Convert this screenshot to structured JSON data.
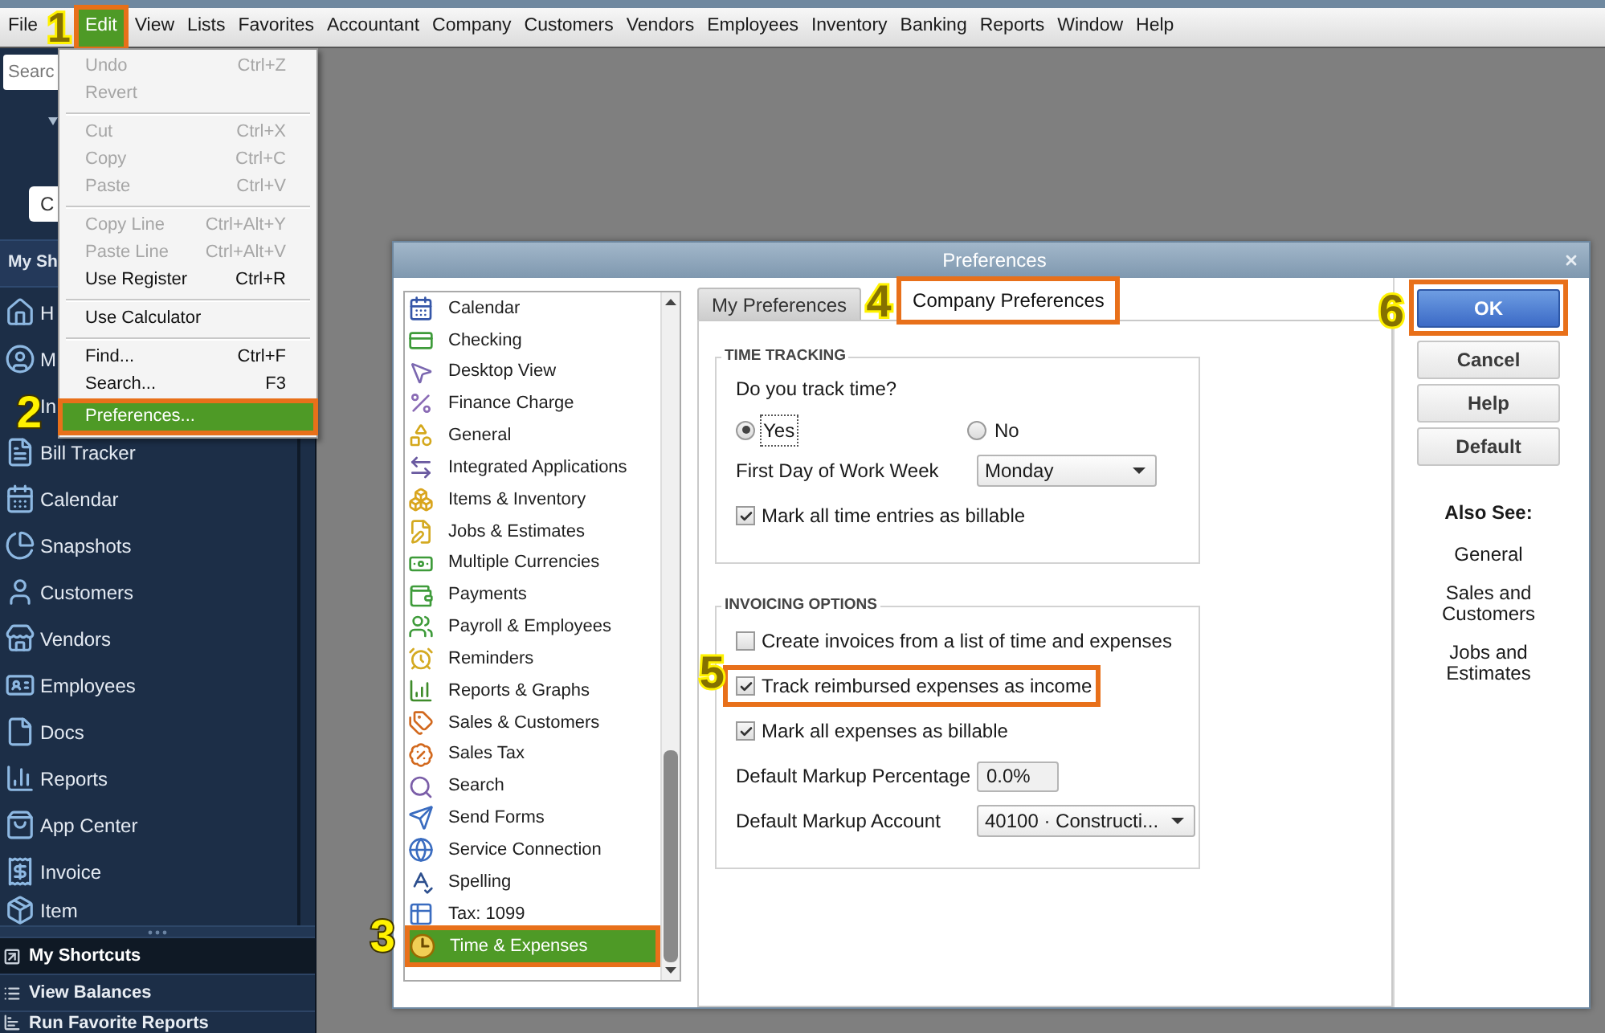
{
  "menu_bar": [
    {
      "label": "File",
      "selected": false
    },
    {
      "label": "Edit",
      "selected": true,
      "callout": "1"
    },
    {
      "label": "View",
      "selected": false
    },
    {
      "label": "Lists",
      "selected": false
    },
    {
      "label": "Favorites",
      "selected": false
    },
    {
      "label": "Accountant",
      "selected": false
    },
    {
      "label": "Company",
      "selected": false
    },
    {
      "label": "Customers",
      "selected": false
    },
    {
      "label": "Vendors",
      "selected": false
    },
    {
      "label": "Employees",
      "selected": false
    },
    {
      "label": "Inventory",
      "selected": false
    },
    {
      "label": "Banking",
      "selected": false
    },
    {
      "label": "Reports",
      "selected": false
    },
    {
      "label": "Window",
      "selected": false
    },
    {
      "label": "Help",
      "selected": false
    }
  ],
  "edit_menu": {
    "groups": [
      [
        {
          "label": "Undo",
          "shortcut": "Ctrl+Z",
          "disabled": true,
          "selected": false
        },
        {
          "label": "Revert",
          "disabled": true,
          "selected": false
        }
      ],
      [
        {
          "label": "Cut",
          "shortcut": "Ctrl+X",
          "disabled": true,
          "selected": false
        },
        {
          "label": "Copy",
          "shortcut": "Ctrl+C",
          "disabled": true,
          "selected": false
        },
        {
          "label": "Paste",
          "shortcut": "Ctrl+V",
          "disabled": true,
          "selected": false
        }
      ],
      [
        {
          "label": "Copy Line",
          "shortcut": "Ctrl+Alt+Y",
          "disabled": true,
          "selected": false
        },
        {
          "label": "Paste Line",
          "shortcut": "Ctrl+Alt+V",
          "disabled": true,
          "selected": false
        },
        {
          "label": "Use Register",
          "shortcut": "Ctrl+R",
          "disabled": false,
          "selected": false
        }
      ],
      [
        {
          "label": "Use Calculator",
          "disabled": false,
          "selected": false
        }
      ],
      [
        {
          "label": "Find...",
          "shortcut": "Ctrl+F",
          "disabled": false,
          "selected": false
        },
        {
          "label": "Search...",
          "shortcut": "F3",
          "disabled": false,
          "selected": false
        },
        {
          "label": "Preferences...",
          "disabled": false,
          "selected": true,
          "callout": "2"
        }
      ]
    ]
  },
  "sidebar": {
    "search": {
      "placeholder": "Searc"
    },
    "button": "C",
    "section_title": "My Sh",
    "items": [
      {
        "label": "H"
      },
      {
        "label": "M"
      },
      {
        "label": "In"
      },
      {
        "label": "Bill Tracker"
      },
      {
        "label": "Calendar"
      },
      {
        "label": "Snapshots"
      },
      {
        "label": "Customers"
      },
      {
        "label": "Vendors"
      },
      {
        "label": "Employees"
      },
      {
        "label": "Docs"
      },
      {
        "label": "Reports"
      },
      {
        "label": "App Center"
      },
      {
        "label": "Invoice"
      },
      {
        "label": "Item"
      }
    ],
    "panels": [
      {
        "label": "My Shortcuts",
        "selected": true
      },
      {
        "label": "View Balances",
        "selected": false
      },
      {
        "label": "Run Favorite Reports",
        "selected": false
      }
    ]
  },
  "preferences_dialog": {
    "title": "Preferences",
    "categories": [
      {
        "label": "Calendar",
        "selected": false
      },
      {
        "label": "Checking",
        "selected": false
      },
      {
        "label": "Desktop View",
        "selected": false
      },
      {
        "label": "Finance Charge",
        "selected": false
      },
      {
        "label": "General",
        "selected": false
      },
      {
        "label": "Integrated Applications",
        "selected": false
      },
      {
        "label": "Items & Inventory",
        "selected": false
      },
      {
        "label": "Jobs & Estimates",
        "selected": false
      },
      {
        "label": "Multiple Currencies",
        "selected": false
      },
      {
        "label": "Payments",
        "selected": false
      },
      {
        "label": "Payroll & Employees",
        "selected": false
      },
      {
        "label": "Reminders",
        "selected": false
      },
      {
        "label": "Reports & Graphs",
        "selected": false
      },
      {
        "label": "Sales & Customers",
        "selected": false
      },
      {
        "label": "Sales Tax",
        "selected": false
      },
      {
        "label": "Search",
        "selected": false
      },
      {
        "label": "Send Forms",
        "selected": false
      },
      {
        "label": "Service Connection",
        "selected": false
      },
      {
        "label": "Spelling",
        "selected": false
      },
      {
        "label": "Tax: 1099",
        "selected": false
      },
      {
        "label": "Time & Expenses",
        "selected": true,
        "callout": "3"
      }
    ],
    "tabs": [
      {
        "label": "My Preferences",
        "selected": false
      },
      {
        "label": "Company Preferences",
        "selected": true,
        "callout": "4"
      }
    ],
    "groups": [
      {
        "title": "TIME TRACKING",
        "rows": [
          {
            "kind": "question",
            "label": "Do you track time?"
          },
          {
            "kind": "radio",
            "options": [
              {
                "label": "Yes",
                "selected": true
              },
              {
                "label": "No",
                "selected": false
              }
            ]
          },
          {
            "kind": "select",
            "label": "First Day of Work Week",
            "value": "Monday"
          },
          {
            "kind": "checkbox",
            "label": "Mark all time entries as billable",
            "checked": true
          }
        ]
      },
      {
        "title": "INVOICING OPTIONS",
        "rows": [
          {
            "kind": "checkbox",
            "label": "Create invoices from a list of time and expenses",
            "checked": false
          },
          {
            "kind": "checkbox",
            "label": "Track reimbursed expenses as income",
            "checked": true,
            "callout": "5"
          },
          {
            "kind": "checkbox",
            "label": "Mark all expenses as billable",
            "checked": true
          },
          {
            "kind": "text_field",
            "label": "Default Markup Percentage",
            "value": "0.0%"
          },
          {
            "kind": "select",
            "label": "Default Markup Account",
            "value": "40100 · Constructi..."
          }
        ]
      }
    ],
    "buttons": [
      {
        "label": "OK",
        "primary": true,
        "callout": "6"
      },
      {
        "label": "Cancel",
        "primary": false
      },
      {
        "label": "Help",
        "primary": false
      },
      {
        "label": "Default",
        "primary": false
      }
    ],
    "also_see": {
      "title": "Also See:",
      "links": [
        "General",
        "Sales and Customers",
        "Jobs and Estimates"
      ]
    }
  }
}
